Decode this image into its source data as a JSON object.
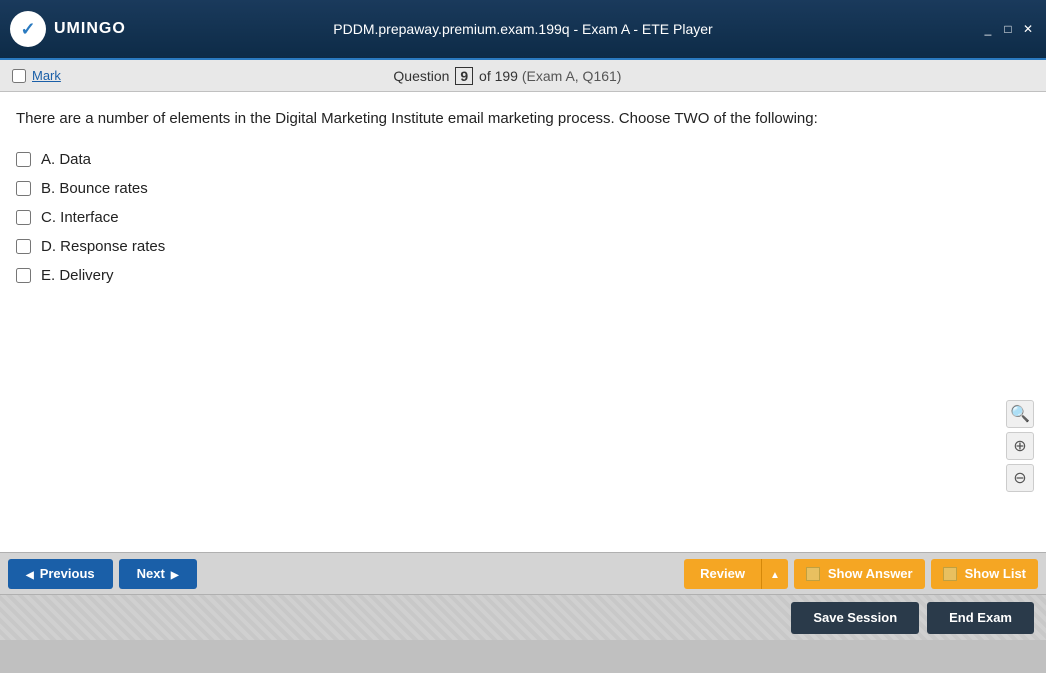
{
  "titleBar": {
    "title": "PDDM.prepaway.premium.exam.199q - Exam A - ETE Player",
    "logoText": "UMINGO",
    "minimizeLabel": "_",
    "maximizeLabel": "□",
    "closeLabel": "✕"
  },
  "toolbar": {
    "markLabel": "Mark",
    "questionLabel": "Question",
    "questionNumber": "9",
    "questionTotal": "of 199",
    "questionRef": "(Exam A, Q161)"
  },
  "question": {
    "text": "There are a number of elements in the Digital Marketing Institute email marketing process. Choose TWO of the following:",
    "options": [
      {
        "id": "A",
        "label": "A. Data"
      },
      {
        "id": "B",
        "label": "B. Bounce rates"
      },
      {
        "id": "C",
        "label": "C. Interface"
      },
      {
        "id": "D",
        "label": "D. Response rates"
      },
      {
        "id": "E",
        "label": "E. Delivery"
      }
    ]
  },
  "navigation": {
    "previousLabel": "Previous",
    "nextLabel": "Next",
    "reviewLabel": "Review",
    "showAnswerLabel": "Show Answer",
    "showListLabel": "Show List"
  },
  "actions": {
    "saveSessionLabel": "Save Session",
    "endExamLabel": "End Exam"
  },
  "icons": {
    "search": "🔍",
    "zoomIn": "⊕",
    "zoomOut": "⊖"
  }
}
